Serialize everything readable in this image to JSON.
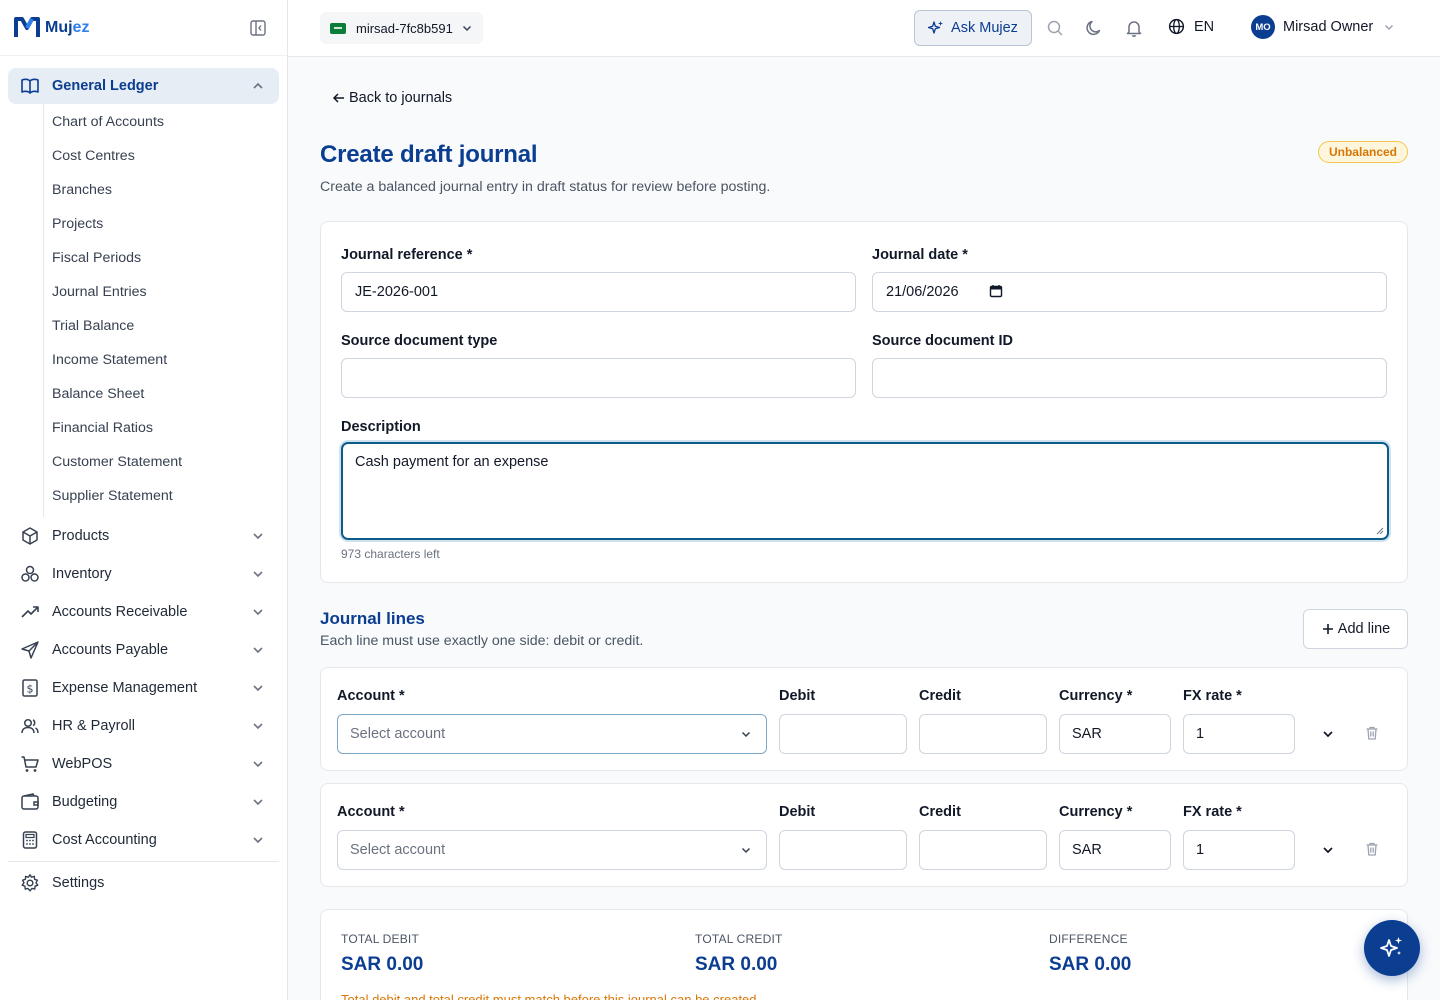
{
  "brand": {
    "name_main": "Muj",
    "name_accent": "ez"
  },
  "sidebar": {
    "active_group": {
      "label": "General Ledger"
    },
    "sub_items": [
      "Chart of Accounts",
      "Cost Centres",
      "Branches",
      "Projects",
      "Fiscal Periods",
      "Journal Entries",
      "Trial Balance",
      "Income Statement",
      "Balance Sheet",
      "Financial Ratios",
      "Customer Statement",
      "Supplier Statement"
    ],
    "groups": [
      {
        "label": "Products",
        "icon": "box-icon"
      },
      {
        "label": "Inventory",
        "icon": "boxes-icon"
      },
      {
        "label": "Accounts Receivable",
        "icon": "trending-up-icon"
      },
      {
        "label": "Accounts Payable",
        "icon": "send-icon"
      },
      {
        "label": "Expense Management",
        "icon": "receipt-icon"
      },
      {
        "label": "HR & Payroll",
        "icon": "users-icon"
      },
      {
        "label": "WebPOS",
        "icon": "cart-icon"
      },
      {
        "label": "Budgeting",
        "icon": "wallet-icon"
      },
      {
        "label": "Cost Accounting",
        "icon": "calculator-icon"
      }
    ],
    "settings": {
      "label": "Settings"
    }
  },
  "topbar": {
    "tenant": "mirsad-7fc8b591",
    "ask_label": "Ask Mujez",
    "language": "EN",
    "user_initials": "MO",
    "user_name": "Mirsad Owner"
  },
  "page": {
    "back_label": "Back to journals",
    "title": "Create draft journal",
    "subtitle": "Create a balanced journal entry in draft status for review before posting.",
    "status_badge": "Unbalanced"
  },
  "form": {
    "reference_label": "Journal reference *",
    "reference_value": "JE-2026-001",
    "date_label": "Journal date *",
    "date_value": "21/06/2026",
    "source_type_label": "Source document type",
    "source_type_value": "",
    "source_id_label": "Source document ID",
    "source_id_value": "",
    "description_label": "Description",
    "description_value": "Cash payment for an expense",
    "chars_left": "973 characters left"
  },
  "lines": {
    "title": "Journal lines",
    "subtitle": "Each line must use exactly one side: debit or credit.",
    "add_label": "Add line",
    "col_account": "Account *",
    "col_debit": "Debit",
    "col_credit": "Credit",
    "col_currency": "Currency *",
    "col_fx": "FX rate *",
    "rows": [
      {
        "account_placeholder": "Select account",
        "debit": "",
        "credit": "",
        "currency": "SAR",
        "fx_rate": "1"
      },
      {
        "account_placeholder": "Select account",
        "debit": "",
        "credit": "",
        "currency": "SAR",
        "fx_rate": "1"
      }
    ]
  },
  "totals": {
    "debit_label": "TOTAL DEBIT",
    "debit_value": "SAR 0.00",
    "credit_label": "TOTAL CREDIT",
    "credit_value": "SAR 0.00",
    "difference_label": "DIFFERENCE",
    "difference_value": "SAR 0.00",
    "warning": "Total debit and total credit must match before this journal can be created."
  },
  "colors": {
    "primary": "#0b3d91",
    "accent": "#2f80ed",
    "warning": "#d97706",
    "active_bg": "#e6edf5"
  }
}
